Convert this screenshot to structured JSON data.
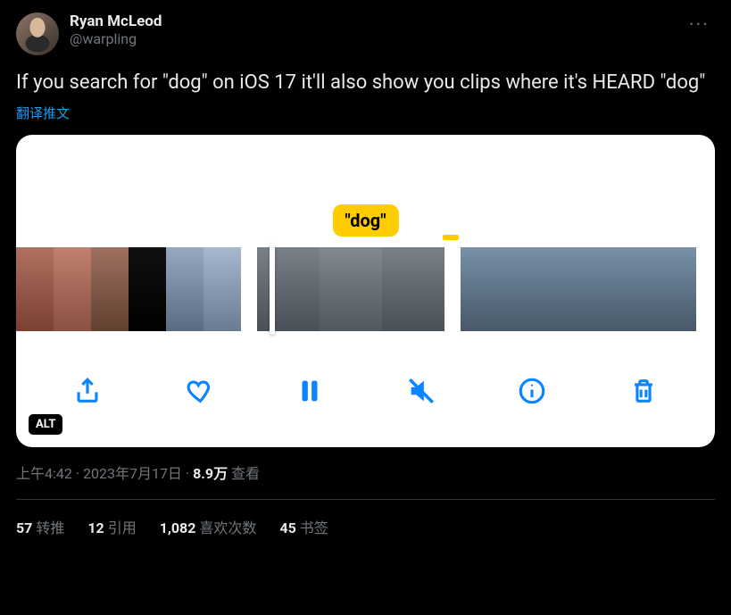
{
  "author": {
    "name": "Ryan McLeod",
    "handle": "@warpling"
  },
  "more_label": "···",
  "body_text": "If you search for \"dog\" on iOS 17 it'll also show you clips where it's HEARD \"dog\"",
  "translate_label": "翻译推文",
  "media": {
    "search_pill": "\"dog\"",
    "alt_badge": "ALT",
    "icons": {
      "share": "share-icon",
      "heart": "heart-icon",
      "pause": "pause-icon",
      "mute": "mute-icon",
      "info": "info-icon",
      "trash": "trash-icon"
    }
  },
  "meta": {
    "time": "上午4:42",
    "sep1": " · ",
    "date": "2023年7月17日",
    "sep2": " · ",
    "views_count": "8.9万",
    "views_label": " 查看"
  },
  "stats": {
    "retweets": {
      "n": "57",
      "label": "转推"
    },
    "quotes": {
      "n": "12",
      "label": "引用"
    },
    "likes": {
      "n": "1,082",
      "label": "喜欢次数"
    },
    "bookmarks": {
      "n": "45",
      "label": "书签"
    }
  }
}
